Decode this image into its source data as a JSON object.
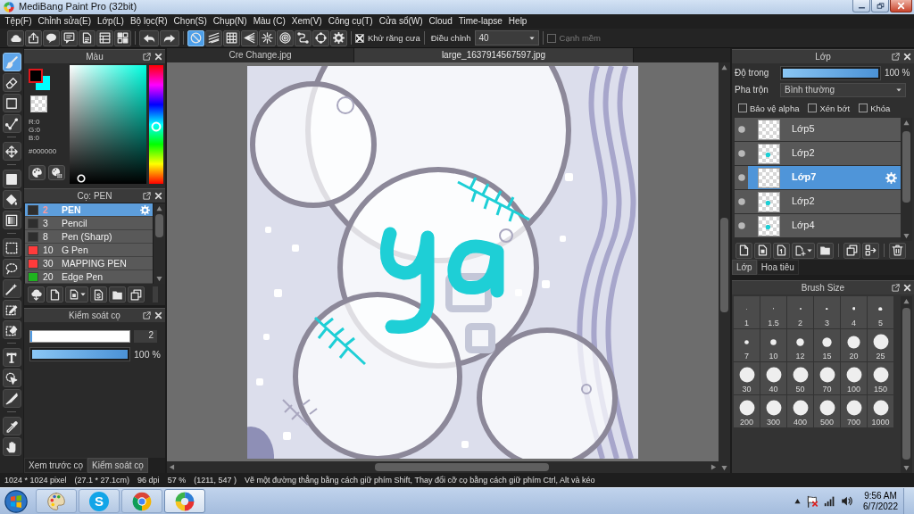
{
  "window": {
    "title": "MediBang Paint Pro (32bit)"
  },
  "menu": [
    "Tệp(F)",
    "Chỉnh sửa(E)",
    "Lớp(L)",
    "Bộ lọc(R)",
    "Chọn(S)",
    "Chụp(N)",
    "Màu (C)",
    "Xem(V)",
    "Công cụ(T)",
    "Cửa sổ(W)",
    "Cloud",
    "Time-lapse",
    "Help"
  ],
  "toolbar": {
    "snap_modes": [
      {
        "kind": "off",
        "selected": true
      },
      {
        "kind": "parallel",
        "selected": false
      },
      {
        "kind": "grid",
        "selected": false
      },
      {
        "kind": "perspective",
        "selected": false
      },
      {
        "kind": "radial",
        "selected": false
      },
      {
        "kind": "concentric",
        "selected": false
      },
      {
        "kind": "curve",
        "selected": false
      },
      {
        "kind": "ellipse",
        "selected": false
      }
    ],
    "antialias": {
      "label": "Khử răng cưa",
      "checked": true,
      "disabled": false
    },
    "correction": {
      "label": "Điều chỉnh",
      "value": "40"
    },
    "soft_edge": {
      "label": "Cạnh mềm",
      "checked": false,
      "disabled": true
    }
  },
  "tools": [
    [
      {
        "kind": "brush",
        "selected": true
      },
      {
        "kind": "eraser",
        "selected": false
      },
      {
        "kind": "square",
        "selected": false
      },
      {
        "kind": "polyline",
        "selected": false
      }
    ],
    [
      {
        "kind": "move",
        "selected": false
      }
    ],
    [
      {
        "kind": "fill",
        "selected": false
      },
      {
        "kind": "bucket",
        "selected": false
      },
      {
        "kind": "gradient",
        "selected": false
      }
    ],
    [
      {
        "kind": "select_rect",
        "selected": false
      },
      {
        "kind": "lasso",
        "selected": false
      },
      {
        "kind": "wand",
        "selected": false
      },
      {
        "kind": "select_pen",
        "selected": false
      },
      {
        "kind": "select_eraser",
        "selected": false
      }
    ],
    [
      {
        "kind": "text",
        "selected": false
      },
      {
        "kind": "operation",
        "selected": false
      },
      {
        "kind": "divide",
        "selected": false
      }
    ],
    [
      {
        "kind": "eyedropper",
        "selected": false
      },
      {
        "kind": "hand",
        "selected": false
      }
    ]
  ],
  "color_panel": {
    "title": "Màu",
    "swatches": [
      {
        "color": "#000000",
        "selected": true
      },
      {
        "color": "#00ffff",
        "selected": false
      }
    ],
    "readout": [
      "R:0",
      "G:0",
      "B:0"
    ],
    "hex": "#000000",
    "hue": {
      "level": 0.52
    }
  },
  "brush_panel": {
    "title": "Cọ: PEN",
    "brushes": [
      {
        "size": "2",
        "name": "PEN",
        "color": "#2e2e2e",
        "selected": true
      },
      {
        "size": "3",
        "name": "Pencil",
        "color": "#2e2e2e",
        "selected": false
      },
      {
        "size": "8",
        "name": "Pen (Sharp)",
        "color": "#2e2e2e",
        "selected": false
      },
      {
        "size": "10",
        "name": "G Pen",
        "color": "#ff3b3b",
        "selected": false
      },
      {
        "size": "30",
        "name": "MAPPING PEN",
        "color": "#ff3b3b",
        "selected": false
      },
      {
        "size": "20",
        "name": "Edge Pen",
        "color": "#1fb31f",
        "selected": false
      }
    ]
  },
  "brush_control": {
    "title": "Kiểm soát cọ",
    "size": {
      "level": 0.02,
      "value": "2"
    },
    "opacity": {
      "level": 1,
      "reading": "100 %"
    }
  },
  "left_tabs": [
    {
      "label": "Xem trước cọ",
      "selected": false
    },
    {
      "label": "Kiểm soát cọ",
      "selected": true
    }
  ],
  "documents": [
    {
      "label": "Cre Change.jpg",
      "selected": false
    },
    {
      "label": "large_1637914567597.jpg",
      "selected": true
    }
  ],
  "layer_panel": {
    "title": "Lớp",
    "opacity": {
      "label": "Độ trong",
      "level": 1,
      "reading": "100 %"
    },
    "blend": {
      "label": "Pha trộn",
      "value": "Bình thường"
    },
    "options": [
      {
        "label": "Bảo vệ alpha",
        "checked": false
      },
      {
        "label": "Xén bớt",
        "checked": false
      },
      {
        "label": "Khóa",
        "checked": false
      }
    ],
    "layers": [
      {
        "name": "Lớp5",
        "kind": "empty",
        "selected": false
      },
      {
        "name": "Lớp2",
        "kind": "marked",
        "selected": false
      },
      {
        "name": "Lớp7",
        "kind": "empty",
        "selected": true
      },
      {
        "name": "Lớp2",
        "kind": "marked",
        "selected": false
      },
      {
        "name": "Lớp4",
        "kind": "marked",
        "selected": false
      }
    ]
  },
  "layer_tabs": [
    {
      "label": "Lớp",
      "selected": true
    },
    {
      "label": "Hoa tiêu",
      "selected": false
    }
  ],
  "brush_size_panel": {
    "title": "Brush Size",
    "sizes": [
      "1",
      "1.5",
      "2",
      "3",
      "4",
      "5",
      "7",
      "10",
      "12",
      "15",
      "20",
      "25",
      "30",
      "40",
      "50",
      "70",
      "100",
      "150",
      "200",
      "300",
      "400",
      "500",
      "700",
      "1000"
    ]
  },
  "status_bar": [
    "1024 * 1024 pixel",
    "(27.1 * 27.1cm)",
    "96 dpi",
    "57 %",
    "(1211, 547 )",
    "Vẽ một đường thẳng bằng cách giữ phím Shift, Thay đổi cỡ cọ bằng cách giữ phím Ctrl, Alt và kéo"
  ],
  "taskbar": {
    "apps": [
      {
        "kind": "palette",
        "selected": false
      },
      {
        "kind": "letter",
        "letter": "S",
        "selected": false
      },
      {
        "kind": "browser",
        "selected": false
      },
      {
        "kind": "ring",
        "selected": true
      }
    ],
    "time": "9:56 AM",
    "date": "6/7/2022"
  }
}
